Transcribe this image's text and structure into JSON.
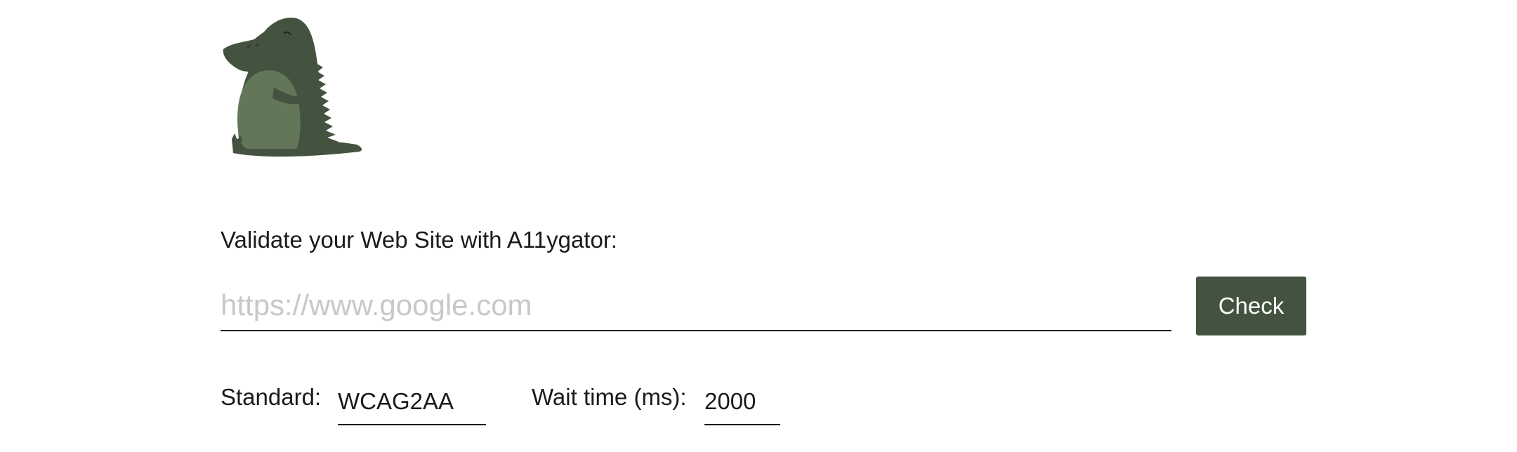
{
  "logo": {
    "icon": "alligator-icon",
    "body_color": "#44533f",
    "belly_color": "#62775a"
  },
  "form": {
    "prompt": "Validate your Web Site with A11ygator:",
    "url_placeholder": "https://www.google.com",
    "url_value": "",
    "check_label": "Check",
    "standard_label": "Standard:",
    "standard_value": "WCAG2AA",
    "wait_label": "Wait time (ms):",
    "wait_value": "2000"
  },
  "colors": {
    "accent": "#44533f",
    "placeholder": "#c8c8c8",
    "text": "#1a1a1a"
  }
}
